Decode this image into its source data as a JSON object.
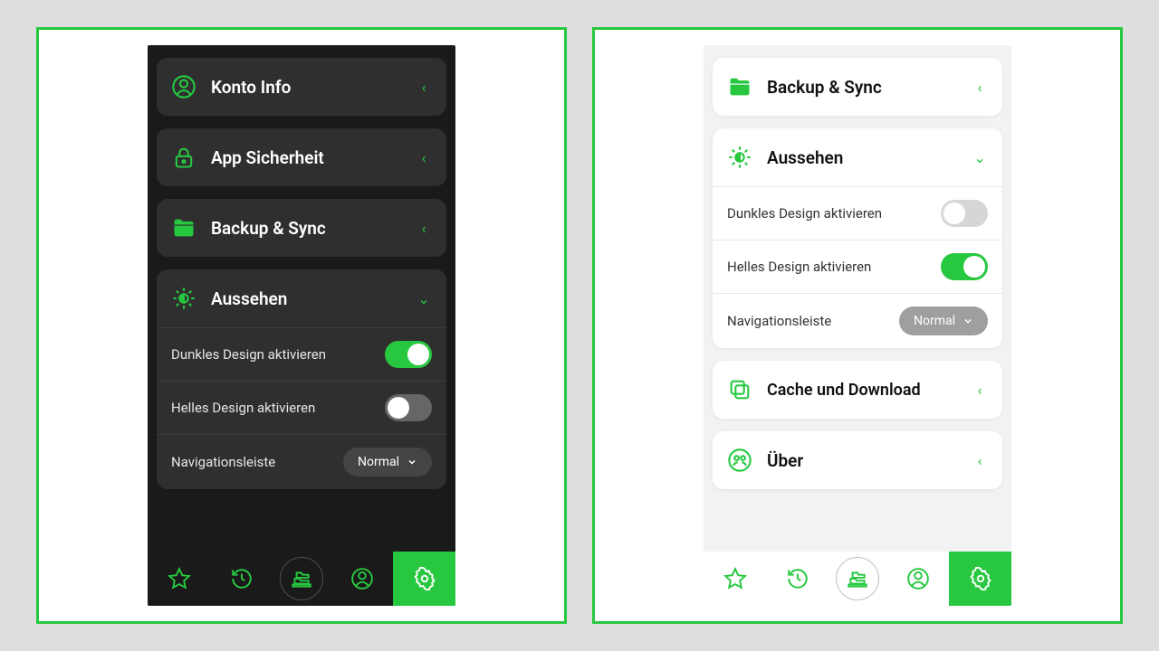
{
  "accent": "#27c840",
  "dark": {
    "items": {
      "konto": "Konto Info",
      "sicherheit": "App Sicherheit",
      "backup": "Backup & Sync",
      "aussehen": "Aussehen",
      "dunkles": "Dunkles Design aktivieren",
      "helles": "Helles Design aktivieren",
      "navleiste": "Navigationsleiste",
      "navvalue": "Normal"
    },
    "toggles": {
      "dunkles": true,
      "helles": false
    }
  },
  "light": {
    "items": {
      "backup": "Backup & Sync",
      "aussehen": "Aussehen",
      "dunkles": "Dunkles Design aktivieren",
      "helles": "Helles Design aktivieren",
      "navleiste": "Navigationsleiste",
      "navvalue": "Normal",
      "cache": "Cache und Download",
      "uber": "Über"
    },
    "toggles": {
      "dunkles": false,
      "helles": true
    }
  }
}
